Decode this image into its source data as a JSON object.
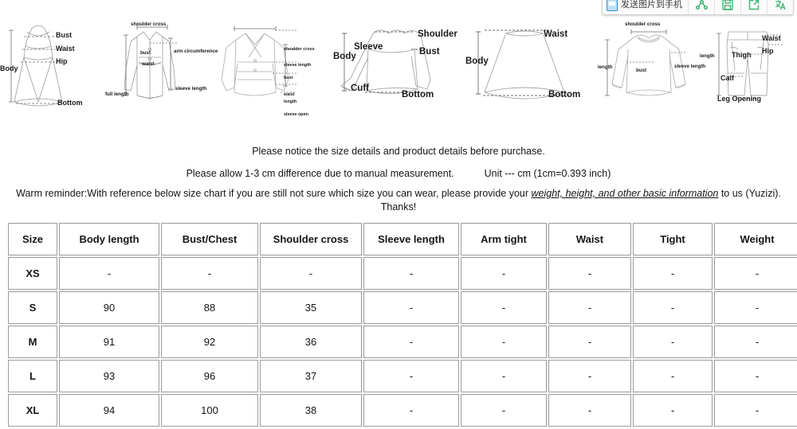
{
  "extension_toolbar": {
    "send_label": "发送图片到手机",
    "phone_icon": "phone-icon",
    "buttons": [
      {
        "name": "share-icon",
        "glyph": "share"
      },
      {
        "name": "save-icon",
        "glyph": "save"
      },
      {
        "name": "open-icon",
        "glyph": "open"
      },
      {
        "name": "translate-icon",
        "glyph": "translate"
      }
    ],
    "accent_color": "#3cb371",
    "phone_icon_color": "#2f8fd0"
  },
  "diagrams": [
    {
      "name": "dress-diagram",
      "labels": [
        "Body",
        "Bust",
        "Waist",
        "Hip",
        "Bottom"
      ]
    },
    {
      "name": "coat-diagram",
      "labels": [
        "shoulder cross",
        "arm circumference",
        "bust",
        "waist",
        "sleeve length",
        "full length"
      ]
    },
    {
      "name": "jacket-diagram",
      "labels": [
        "shoulder cross",
        "sleeve length",
        "bust",
        "waist",
        "length",
        "sleeve open"
      ]
    },
    {
      "name": "sweater-diagram",
      "labels": [
        "Shoulder",
        "Bust",
        "Body",
        "Sleeve",
        "Cuff",
        "Bottom"
      ]
    },
    {
      "name": "skirt-diagram",
      "labels": [
        "Waist",
        "Body",
        "Bottom"
      ]
    },
    {
      "name": "sweatshirt-diagram",
      "labels": [
        "shoulder cross",
        "bust",
        "sleeve length",
        "length"
      ]
    },
    {
      "name": "pants-diagram",
      "labels": [
        "Waist",
        "Hip",
        "Thigh",
        "Calf",
        "Leg Opening",
        "length"
      ]
    }
  ],
  "notices": {
    "line1": "Please notice the size details and product details before purchase.",
    "line2a": "Please allow 1-3 cm difference due to manual measurement.",
    "line2b": "Unit --- cm  (1cm=0.393 inch)",
    "line3_prefix": "Warm reminder:With reference below size chart if you are still not sure which size you can wear, please provide your ",
    "line3_emphasis": "weight, height, and other basic information",
    "line3_suffix": " to us (Yuzizi).",
    "line4": "Thanks!"
  },
  "size_chart": {
    "headers": [
      "Size",
      "Body length",
      "Bust/Chest",
      "Shoulder cross",
      "Sleeve length",
      "Arm tight",
      "Waist",
      "Tight",
      "Weight"
    ],
    "rows": [
      [
        "XS",
        "-",
        "-",
        "-",
        "-",
        "-",
        "-",
        "-",
        "-"
      ],
      [
        "S",
        "90",
        "88",
        "35",
        "-",
        "-",
        "-",
        "-",
        "-"
      ],
      [
        "M",
        "91",
        "92",
        "36",
        "-",
        "-",
        "-",
        "-",
        "-"
      ],
      [
        "L",
        "93",
        "96",
        "37",
        "-",
        "-",
        "-",
        "-",
        "-"
      ],
      [
        "XL",
        "94",
        "100",
        "38",
        "-",
        "-",
        "-",
        "-",
        "-"
      ]
    ]
  }
}
